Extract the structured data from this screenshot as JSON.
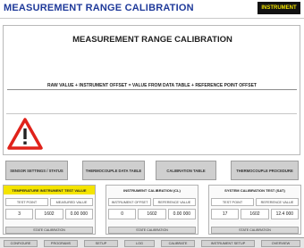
{
  "header": {
    "title": "MEASUREMENT RANGE CALIBRATION",
    "info_left": "",
    "info_right": "",
    "brand": "INSTRUMENT"
  },
  "document": {
    "title": "MEASUREMENT RANGE CALIBRATION",
    "description": "",
    "formula": "RAW VALUE + INSTRUMENT OFFSET = VALUE FROM DATA TABLE + REFERENCE POINT OFFSET",
    "legend_left": "",
    "legend_right": "",
    "warning_text": ""
  },
  "icons": {
    "warning": "warning-triangle-icon",
    "warning_color": "#e0221a"
  },
  "tool_buttons": [
    {
      "label": "SENSOR SETTINGS / STATUS"
    },
    {
      "label": "THERMOCOUPLE DATA TABLE"
    },
    {
      "label": "CALIBRATION TABLE"
    },
    {
      "label": "THERMOCOUPLE PROCEDURE"
    }
  ],
  "status_panels": [
    {
      "heading": "TEMPERATURE INSTRUMENT TEST VALUE",
      "highlight": true,
      "labels": [
        "TEST POINT",
        "MEASURED VALUE"
      ],
      "values": [
        "3",
        "1602",
        "0.00 000"
      ],
      "button": "STATE CALIBRATION"
    },
    {
      "heading": "INSTRUMENT CALIBRATION (CL)",
      "highlight": false,
      "labels": [
        "INSTRUMENT OFFSET",
        "REFERENCE VALUE"
      ],
      "values": [
        "0",
        "1602",
        "0.00 000"
      ],
      "button": "STATE CALIBRATION"
    },
    {
      "heading": "SYSTEM CALIBRATION TEST (SAT)",
      "highlight": false,
      "labels": [
        "TEST POINT",
        "REFERENCE VALUE"
      ],
      "values": [
        "17",
        "1602",
        "12.4 000"
      ],
      "button": "STATE CALIBRATION"
    }
  ],
  "nav": [
    {
      "label": "CONFIGURE"
    },
    {
      "label": "PROGRAMS"
    },
    {
      "label": "SETUP"
    },
    {
      "label": "LOG"
    },
    {
      "label": "CALIBRATE"
    },
    {
      "label": "INSTRUMENT SETUP"
    },
    {
      "label": "OVERVIEW"
    }
  ],
  "colors": {
    "accent_blue": "#1f3a9a",
    "highlight_yellow": "#f4e400",
    "brand_bg": "#111111"
  }
}
